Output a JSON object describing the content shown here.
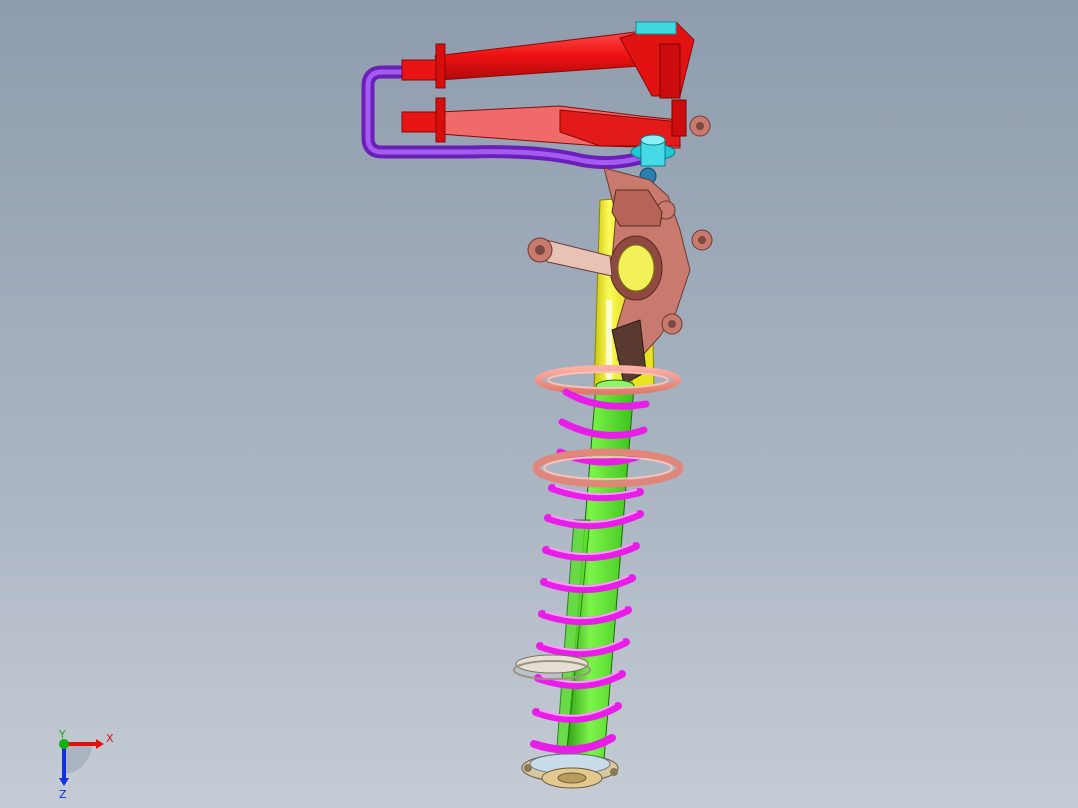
{
  "view": {
    "background_top": "#8e9cad",
    "background_bottom": "#c5ccd5"
  },
  "model": {
    "parts": [
      {
        "name": "upper-control-arm",
        "color": "#ee1111"
      },
      {
        "name": "lower-control-arm",
        "color": "#ee1111"
      },
      {
        "name": "stabilizer-bar",
        "color": "#8a2be2"
      },
      {
        "name": "ball-joint",
        "color": "#22c7d6"
      },
      {
        "name": "steering-knuckle",
        "color": "#c97a6e"
      },
      {
        "name": "strut-upper-housing",
        "color": "#f2ee18"
      },
      {
        "name": "damper-body",
        "color": "#55ee22"
      },
      {
        "name": "coil-spring",
        "color": "#ee22ee"
      },
      {
        "name": "spring-seat",
        "color": "#e8a090"
      },
      {
        "name": "bottom-mount",
        "color": "#d8c8a0"
      }
    ]
  },
  "triad": {
    "x_label": "X",
    "y_label": "Y",
    "z_label": "Z",
    "x_color": "#e01010",
    "y_color": "#10b010",
    "z_color": "#1030e0"
  }
}
